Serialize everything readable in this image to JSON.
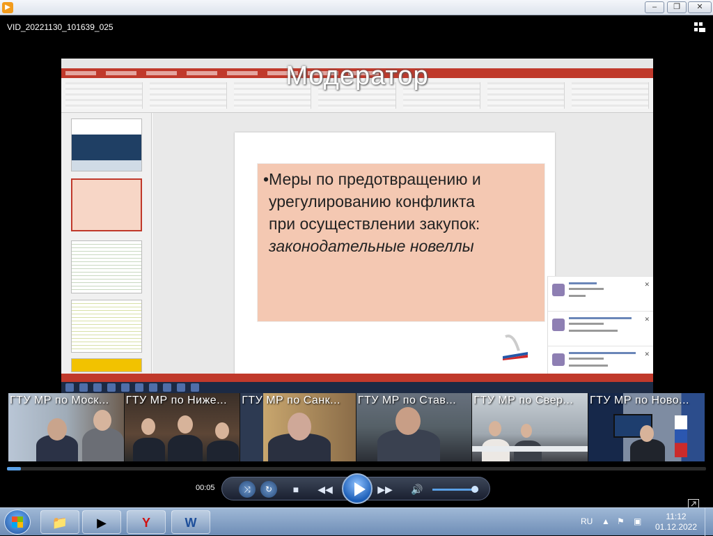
{
  "window": {
    "app_icon": "play-icon",
    "buttons": [
      "minimize",
      "maximize",
      "close"
    ]
  },
  "player": {
    "file_title": "VID_20221130_101639_025",
    "elapsed_time": "00:05",
    "progress_fraction": 0.02,
    "volume_fraction": 0.9
  },
  "video": {
    "overlay_title": "Модератор",
    "slide_text_line1": "•Меры по предотвращению и",
    "slide_text_line2": "урегулированию конфликта",
    "slide_text_line3": "при осуществлении закупок:",
    "slide_text_line4": "законодательные новеллы"
  },
  "participants": [
    {
      "label": "ГТУ МР по Моск..."
    },
    {
      "label": "ГТУ МР по Ниже..."
    },
    {
      "label": "ГТУ МР по Санк..."
    },
    {
      "label": "ГТУ МР по Став..."
    },
    {
      "label": "ГТУ МР по Свер..."
    },
    {
      "label": "ГТУ МР по Ново..."
    }
  ],
  "controls": {
    "shuffle_icon": "shuffle-icon",
    "repeat_icon": "repeat-icon",
    "stop_icon": "stop-icon",
    "previous_icon": "previous-icon",
    "play_icon": "play-icon",
    "next_icon": "next-icon",
    "volume_icon": "volume-icon"
  },
  "taskbar": {
    "language": "RU",
    "time": "11:12",
    "date": "01.12.2022",
    "apps": [
      "file-explorer",
      "media-player",
      "yandex-browser",
      "word"
    ]
  },
  "colors": {
    "slide_box": "#f4c8b2",
    "ppt_accent": "#c0392b",
    "taskbar": "#6e8db6"
  }
}
